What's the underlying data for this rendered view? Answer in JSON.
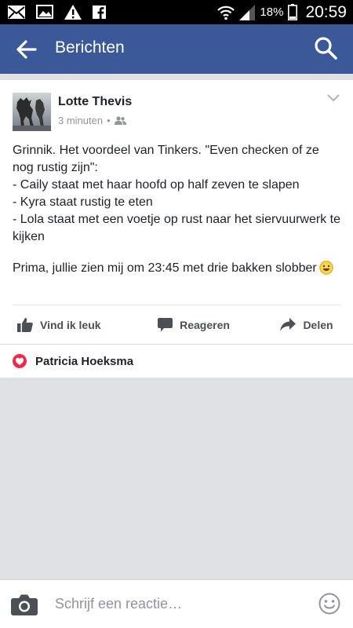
{
  "status_bar": {
    "icons": [
      "mail-icon",
      "image-icon",
      "warning-icon",
      "facebook-icon"
    ],
    "right_icons": [
      "wifi-icon",
      "signal-icon",
      "battery-icon"
    ],
    "battery_percent": "18%",
    "time": "20:59"
  },
  "app_bar": {
    "title": "Berichten",
    "back_icon": "arrow-left-icon",
    "search_icon": "search-icon"
  },
  "post": {
    "author": "Lotte Thevis",
    "timestamp": "3 minuten",
    "separator": "•",
    "audience_icon": "friends-icon",
    "text": {
      "line1": "Grinnik. Het voordeel van Tinkers. \"Even checken of ze nog rustig zijn\":",
      "line2": "- Caily staat met haar hoofd op half zeven te slapen",
      "line3": "- Kyra staat rustig te eten",
      "line4": "- Lola staat met een voetje op rust naar het siervuurwerk te kijken",
      "line5": "Prima, jullie zien mij om 23:45 met drie bakken slobber"
    },
    "emoji": "smiley-emoji",
    "actions": {
      "like": "Vind ik leuk",
      "comment": "Reageren",
      "share": "Delen"
    }
  },
  "likes": {
    "icon": "heart-icon",
    "name": "Patricia Hoeksma"
  },
  "composer": {
    "placeholder": "Schrijf een reactie…",
    "camera_icon": "camera-icon",
    "emoji_icon": "smiley-icon"
  },
  "colors": {
    "brand": "#3b5998",
    "background": "#dfe1e5",
    "heart": "#f0284a"
  }
}
